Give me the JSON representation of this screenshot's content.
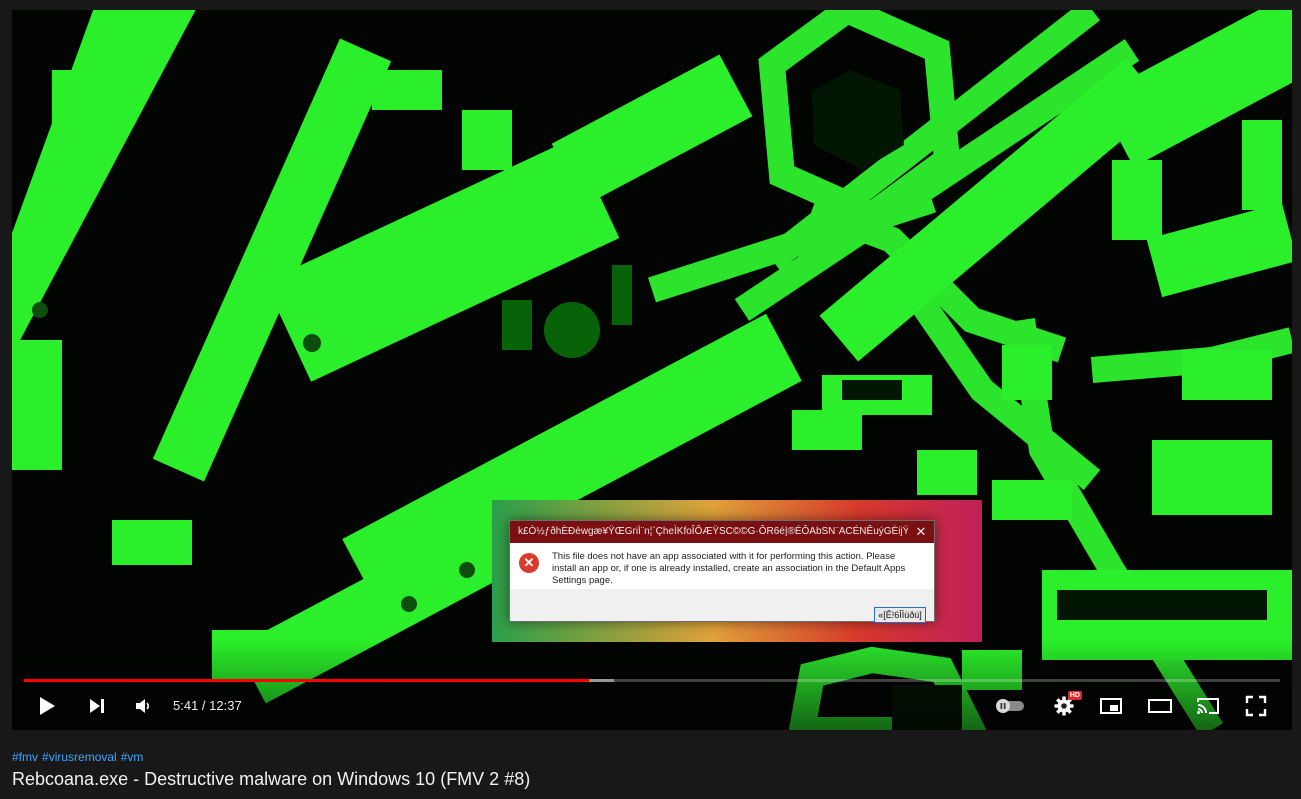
{
  "player": {
    "current_time": "5:41",
    "time_separator": " / ",
    "duration": "12:37",
    "progress_fraction": 0.45,
    "buffered_fraction": 0.47,
    "progress_color": "#ff0000",
    "hd_badge": "HD",
    "controls": {
      "play": "play-icon",
      "next": "next-icon",
      "volume": "volume-icon",
      "autoplay": "autoplay-toggle",
      "settings": "gear-icon",
      "miniplayer": "miniplayer-icon",
      "theater": "theater-icon",
      "cast": "cast-icon",
      "fullscreen": "fullscreen-icon"
    }
  },
  "video_content": {
    "dialog_title": "k£Ò½ƒðhÈÐèwgæ¥ŸŒGriÌ¨n¦`ÇheÌKfoÎÔÆŸSC©©G·ÔR6é|®ÉÔAbSN¨ACÉNÊuýGÈijŸwÉJ}cz·nùáàjrÙ...",
    "dialog_close": "✕",
    "dialog_message": "This file does not have an app associated with it for performing this action. Please install an app or, if one is already installed, create an association in the Default Apps Settings page.",
    "dialog_button": "«[Ê!6ÎÌùðú]"
  },
  "hashtags": [
    "#fmv",
    "#virusremoval",
    "#vm"
  ],
  "hashtag_color": "#3ea6ff",
  "title": "Rebcoana.exe - Destructive malware on Windows 10 (FMV 2 #8)"
}
